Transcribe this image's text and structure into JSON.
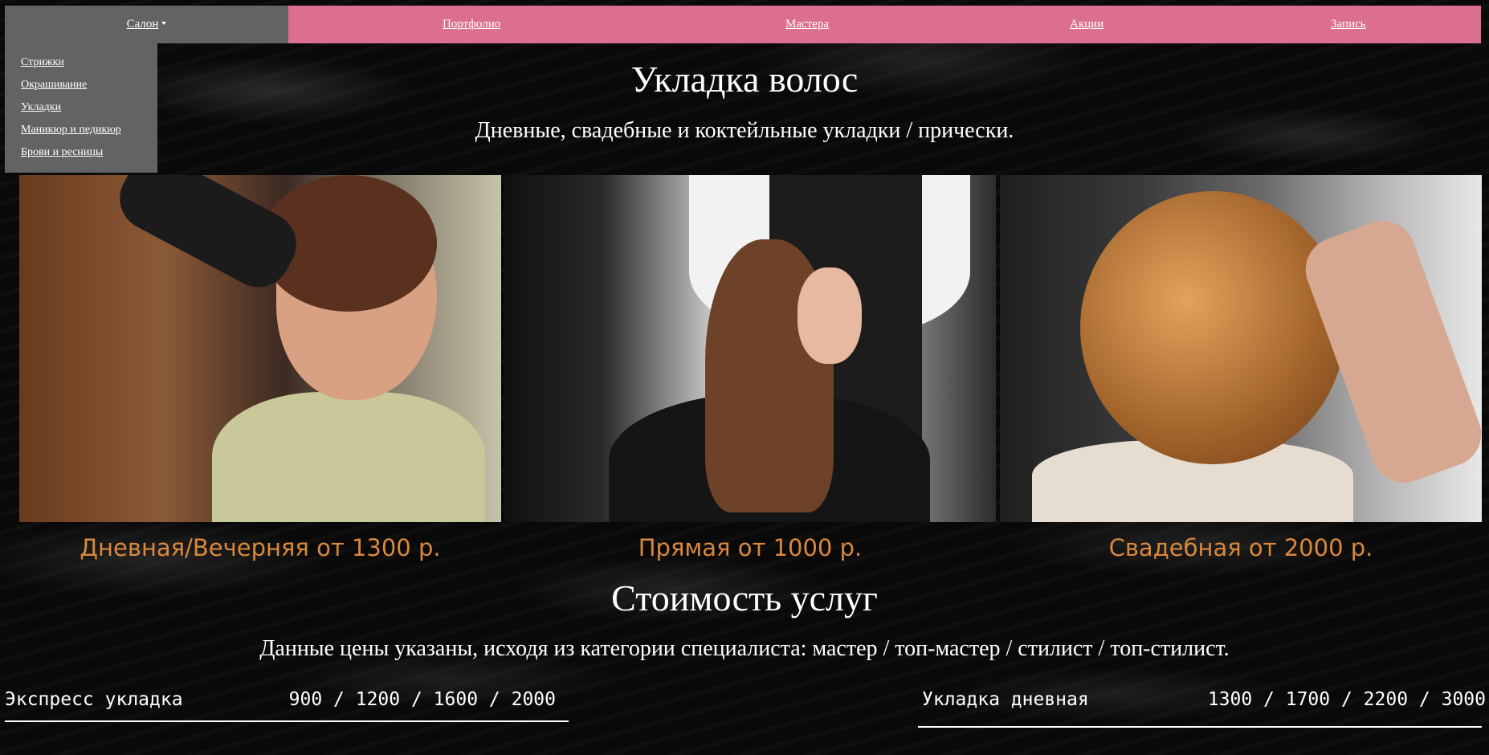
{
  "nav": {
    "salon": "Салон",
    "portfolio": "Портфолио",
    "masters": "Мастера",
    "promotions": "Акции",
    "booking": "Запись"
  },
  "dropdown": {
    "items": [
      "Стрижки",
      "Окрашивание",
      "Укладки",
      "Маникюр и педикюр",
      "Брови и ресницы"
    ]
  },
  "page": {
    "title": "Укладка волос",
    "subtitle": "Дневные, свадебные и коктейльные укладки / прически."
  },
  "services": [
    {
      "caption": "Дневная/Вечерняя от 1300 р."
    },
    {
      "caption": "Прямая от 1000 р."
    },
    {
      "caption": "Свадебная от 2000 р."
    }
  ],
  "pricing": {
    "title": "Стоимость услуг",
    "subtitle": "Данные цены указаны, исходя из категории специалиста: мастер / топ-мастер / стилист / топ-стилист.",
    "rows": [
      {
        "name": "Экспресс укладка",
        "prices": "900 / 1200 / 1600 / 2000"
      },
      {
        "name": "Укладка дневная",
        "prices": "1300 / 1700 / 2200 / 3000"
      }
    ]
  },
  "colors": {
    "nav_pink": "#dc6f8e",
    "nav_gray": "#636363",
    "caption_orange": "#d9883d"
  }
}
